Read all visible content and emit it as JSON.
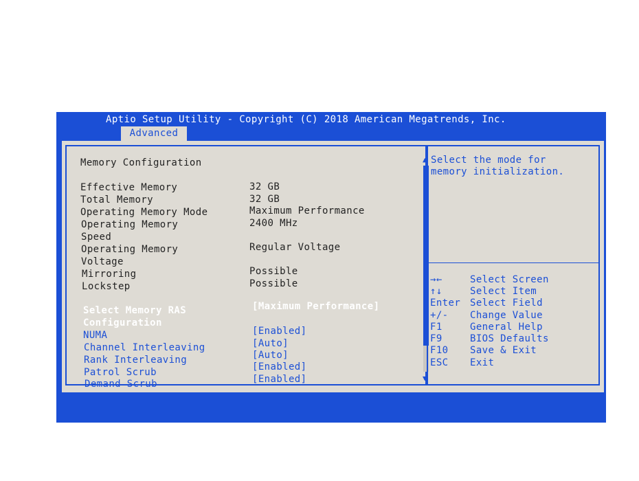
{
  "title": "Aptio Setup Utility - Copyright (C) 2018 American Megatrends, Inc.",
  "tab": "Advanced",
  "section_title": "Memory Configuration",
  "info_rows": [
    {
      "label": "Effective Memory",
      "value": "32 GB"
    },
    {
      "label": "Total Memory",
      "value": "32 GB"
    },
    {
      "label": "Operating Memory Mode",
      "value": "Maximum Performance"
    },
    {
      "label_lines": [
        "Operating Memory",
        "Speed"
      ],
      "value": "2400 MHz"
    },
    {
      "label_lines": [
        "Operating Memory",
        "Voltage"
      ],
      "value": "Regular Voltage"
    },
    {
      "label_lines": [
        "Mirroring",
        "Lockstep"
      ],
      "values": [
        "Possible",
        "Possible"
      ]
    }
  ],
  "options": [
    {
      "label_lines": [
        "Select Memory RAS",
        "Configuration"
      ],
      "value": "[Maximum Performance]",
      "selected": true
    },
    {
      "label": "NUMA",
      "value": "[Enabled]"
    },
    {
      "label": "Channel Interleaving",
      "value": "[Auto]"
    },
    {
      "label": "Rank Interleaving",
      "value": "[Auto]"
    },
    {
      "label": "Patrol Scrub",
      "value": "[Enabled]"
    },
    {
      "label": "Demand Scrub",
      "value": "[Enabled]"
    }
  ],
  "help_text": [
    "Select the mode for",
    "memory initialization."
  ],
  "keys": [
    {
      "key": "→←",
      "desc": "Select Screen"
    },
    {
      "key": "↑↓",
      "desc": "Select Item"
    },
    {
      "key": "Enter",
      "desc": "Select Field"
    },
    {
      "key": "+/-",
      "desc": "Change Value"
    },
    {
      "key": "F1",
      "desc": "General Help"
    },
    {
      "key": "F9",
      "desc": "BIOS Defaults"
    },
    {
      "key": "F10",
      "desc": "Save & Exit"
    },
    {
      "key": "ESC",
      "desc": "Exit"
    }
  ],
  "colors": {
    "bios_blue": "#1b4fd6",
    "panel_gray": "#dedbd4",
    "selected_text": "#ffffff"
  },
  "icons": {
    "scroll_up": "up-arrow-icon",
    "scroll_down": "down-arrow-icon"
  }
}
